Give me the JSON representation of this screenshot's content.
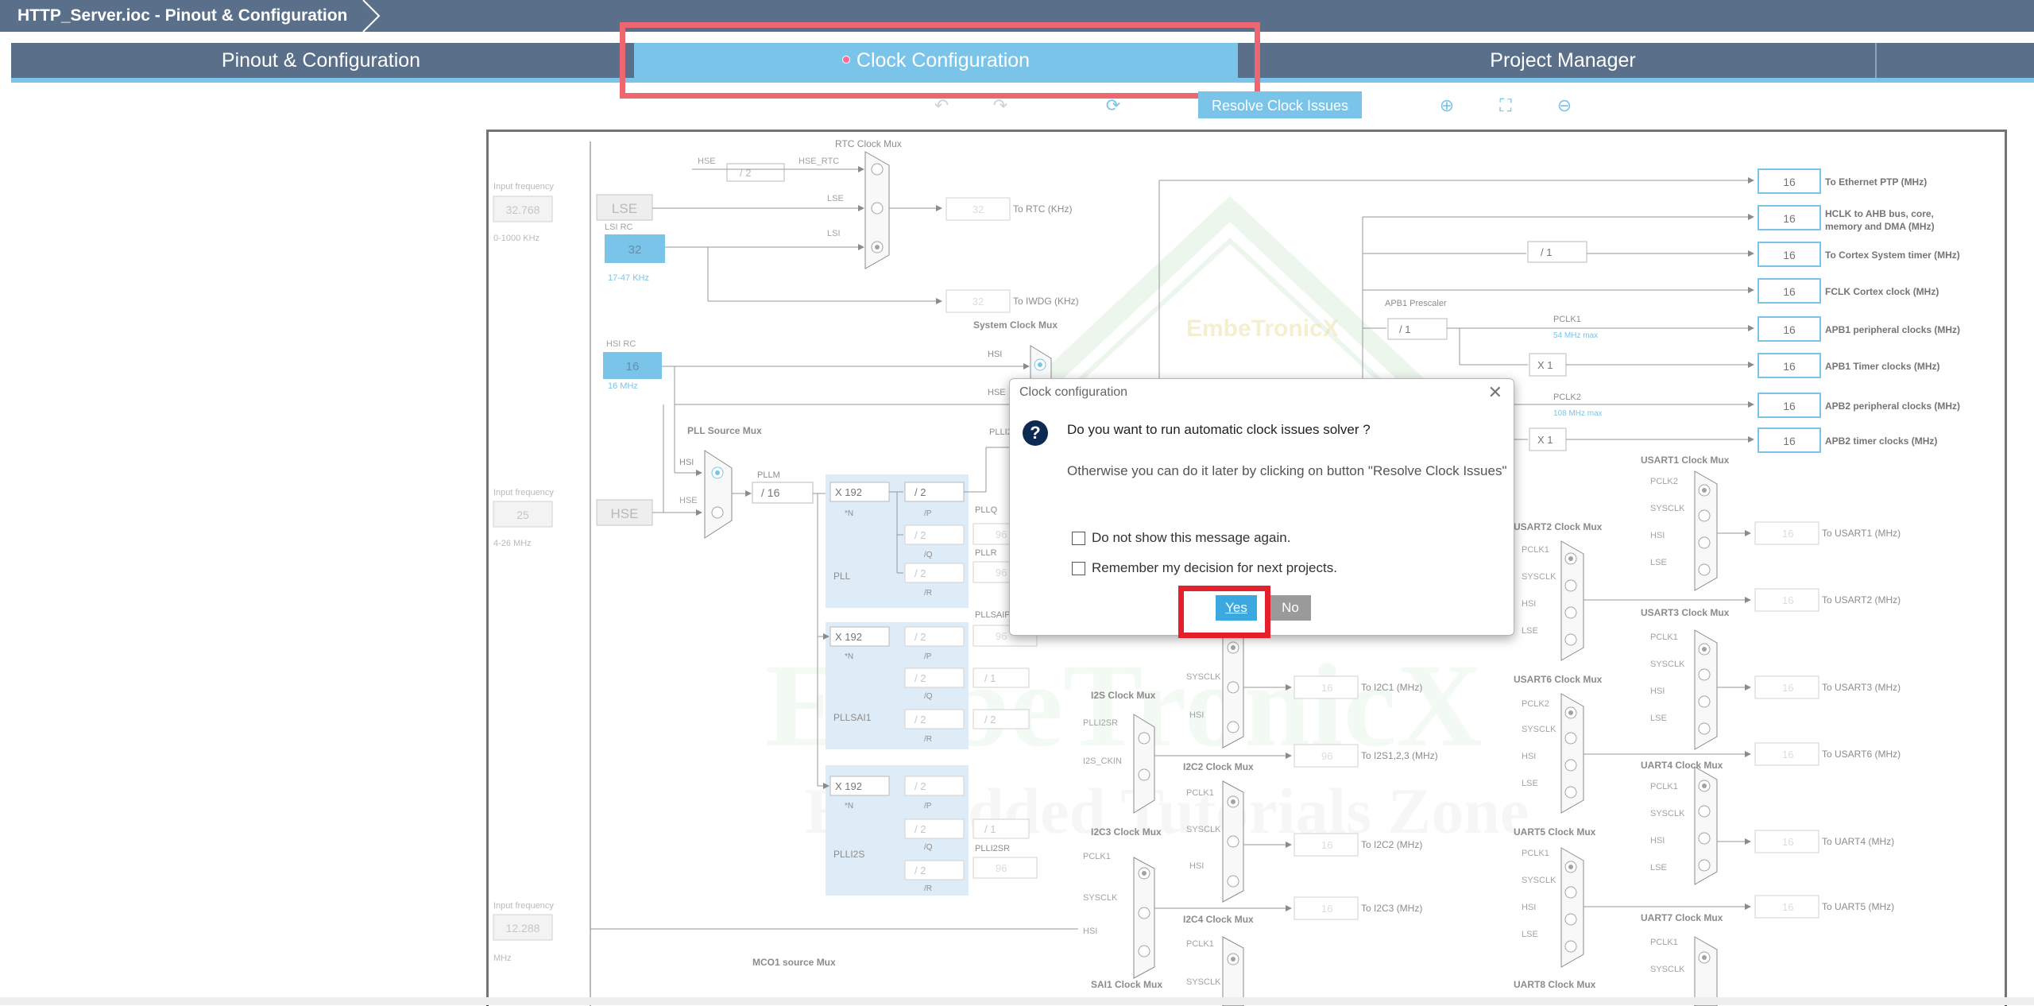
{
  "window": {
    "title": "HTTP_Server.ioc - Pinout & Configuration"
  },
  "tabs": [
    {
      "label": "Pinout & Configuration",
      "active": false
    },
    {
      "label": "Clock Configuration",
      "active": true
    },
    {
      "label": "Project Manager",
      "active": false
    }
  ],
  "toolbar": {
    "resolve_label": "Resolve Clock Issues",
    "icons": [
      "undo-icon",
      "redo-icon",
      "refresh-icon",
      "zoom-in-icon",
      "fit-icon",
      "zoom-out-icon"
    ]
  },
  "watermark": {
    "brand": "EmbeTronicX",
    "tagline": "Embedded Tutorials Zone"
  },
  "diagram": {
    "input_freq_label": "Input frequency",
    "lse": {
      "freq": "32.768",
      "range": "0-1000 KHz",
      "label": "LSE"
    },
    "lsi": {
      "label": "LSI RC",
      "value": "32",
      "range": "17-47 KHz"
    },
    "hsi": {
      "label": "HSI RC",
      "value": "16",
      "unit": "16 MHz"
    },
    "hse": {
      "freq": "25",
      "range": "4-26 MHz",
      "label": "HSE"
    },
    "i2s_in": {
      "freq": "12.288",
      "unit": "MHz"
    },
    "rtc_mux": "RTC Clock Mux",
    "hse_rtc": "HSE_RTC",
    "div2": "/ 2",
    "to_rtc": {
      "value": "32",
      "label": "To RTC (KHz)"
    },
    "to_iwdg": {
      "value": "32",
      "label": "To IWDG (KHz)"
    },
    "system_mux": "System Clock Mux",
    "pll_source_mux": "PLL Source Mux",
    "pllm": {
      "label": "PLLM",
      "value": "/ 16"
    },
    "pll_main": {
      "n": "X 192",
      "p": "/ 2",
      "q": "/ 2",
      "r": "/ 2",
      "q_out": "96",
      "r_out": "96",
      "label": "PLL",
      "plloq": "PLLQ",
      "pllr": "PLLR"
    },
    "pllsai": {
      "n": "X 192",
      "p": "/ 2",
      "q": "/ 2",
      "r": "/ 2",
      "q2": "/ 1",
      "r2": "/ 2",
      "p_out": "96",
      "label": "PLLSAI1",
      "out_label": "PLLSAIP"
    },
    "plli2s": {
      "n": "X 192",
      "p": "/ 2",
      "q": "/ 2",
      "r": "/ 2",
      "q2": "/ 1",
      "out": "96",
      "label": "PLLI2S",
      "out_label": "PLLI2SR"
    },
    "apb1_prescaler": {
      "label": "APB1 Prescaler",
      "value": "/ 1"
    },
    "ahb_div": "/ 1",
    "pclk1": {
      "label": "PCLK1",
      "max": "54 MHz max"
    },
    "pclk2": {
      "label": "PCLK2",
      "max": "108 MHz max"
    },
    "x1": "X 1",
    "outputs": [
      {
        "value": "16",
        "label": "To Ethernet PTP (MHz)"
      },
      {
        "value": "16",
        "label": "HCLK to AHB bus, core,",
        "label2": "memory and DMA (MHz)"
      },
      {
        "value": "16",
        "label": "To Cortex System timer (MHz)"
      },
      {
        "value": "16",
        "label": "FCLK Cortex clock (MHz)"
      },
      {
        "value": "16",
        "label": "APB1 peripheral clocks (MHz)"
      },
      {
        "value": "16",
        "label": "APB1 Timer clocks (MHz)"
      },
      {
        "value": "16",
        "label": "APB2 peripheral clocks (MHz)"
      },
      {
        "value": "16",
        "label": "APB2 timer clocks (MHz)"
      }
    ],
    "usart_outputs": [
      {
        "mux": "USART1 Clock Mux",
        "value": "16",
        "label": "To USART1 (MHz)"
      },
      {
        "mux": "USART2 Clock Mux",
        "value": "16",
        "label": "To USART2 (MHz)"
      },
      {
        "mux": "USART3 Clock Mux",
        "value": "16",
        "label": "To USART3 (MHz)"
      },
      {
        "mux": "USART6 Clock Mux",
        "value": "16",
        "label": "To USART6 (MHz)"
      },
      {
        "mux": "UART4 Clock Mux",
        "value": "16",
        "label": "To UART4 (MHz)"
      },
      {
        "mux": "UART5 Clock Mux",
        "value": "16",
        "label": "To UART5 (MHz)"
      },
      {
        "mux": "UART7 Clock Mux",
        "value": "",
        "label": ""
      },
      {
        "mux": "UART8 Clock Mux",
        "value": "",
        "label": ""
      }
    ],
    "i2c_outputs": [
      {
        "value": "16",
        "label": "To I2C1 (MHz)"
      },
      {
        "value": "96",
        "label": "To I2S1,2,3 (MHz)"
      },
      {
        "value": "16",
        "label": "To I2C2 (MHz)"
      },
      {
        "value": "16",
        "label": "To I2C3 (MHz)"
      }
    ],
    "mux_labels": {
      "i2s": "I2S Clock Mux",
      "i2c2": "I2C2 Clock Mux",
      "i2c3": "I2C3 Clock Mux",
      "i2c4": "I2C4 Clock Mux",
      "sai1": "SAI1 Clock Mux",
      "mco1": "MCO1 source Mux"
    },
    "sig": {
      "hse": "HSE",
      "lse": "LSE",
      "lsi": "LSI",
      "hsi": "HSI",
      "pclk1": "PCLK1",
      "pclk2": "PCLK2",
      "sysclk": "SYSCLK",
      "plli2sr": "PLLI2SR",
      "i2s_ckin": "I2S_CKIN",
      "p": "/P",
      "q": "/Q",
      "r": "/R",
      "n": "*N"
    }
  },
  "dialog": {
    "title": "Clock configuration",
    "question": "Do you want to run automatic clock issues solver ?",
    "info": "Otherwise you can do it later by clicking on button \"Resolve Clock Issues\"",
    "check1": "Do not show this message again.",
    "check2": "Remember my decision for next projects.",
    "yes": "Yes",
    "no": "No"
  },
  "colors": {
    "navy": "#0d2b52",
    "accent": "#3ba9e0",
    "highlight": "#e3202c",
    "pll_bg": "#cfe3f3"
  }
}
